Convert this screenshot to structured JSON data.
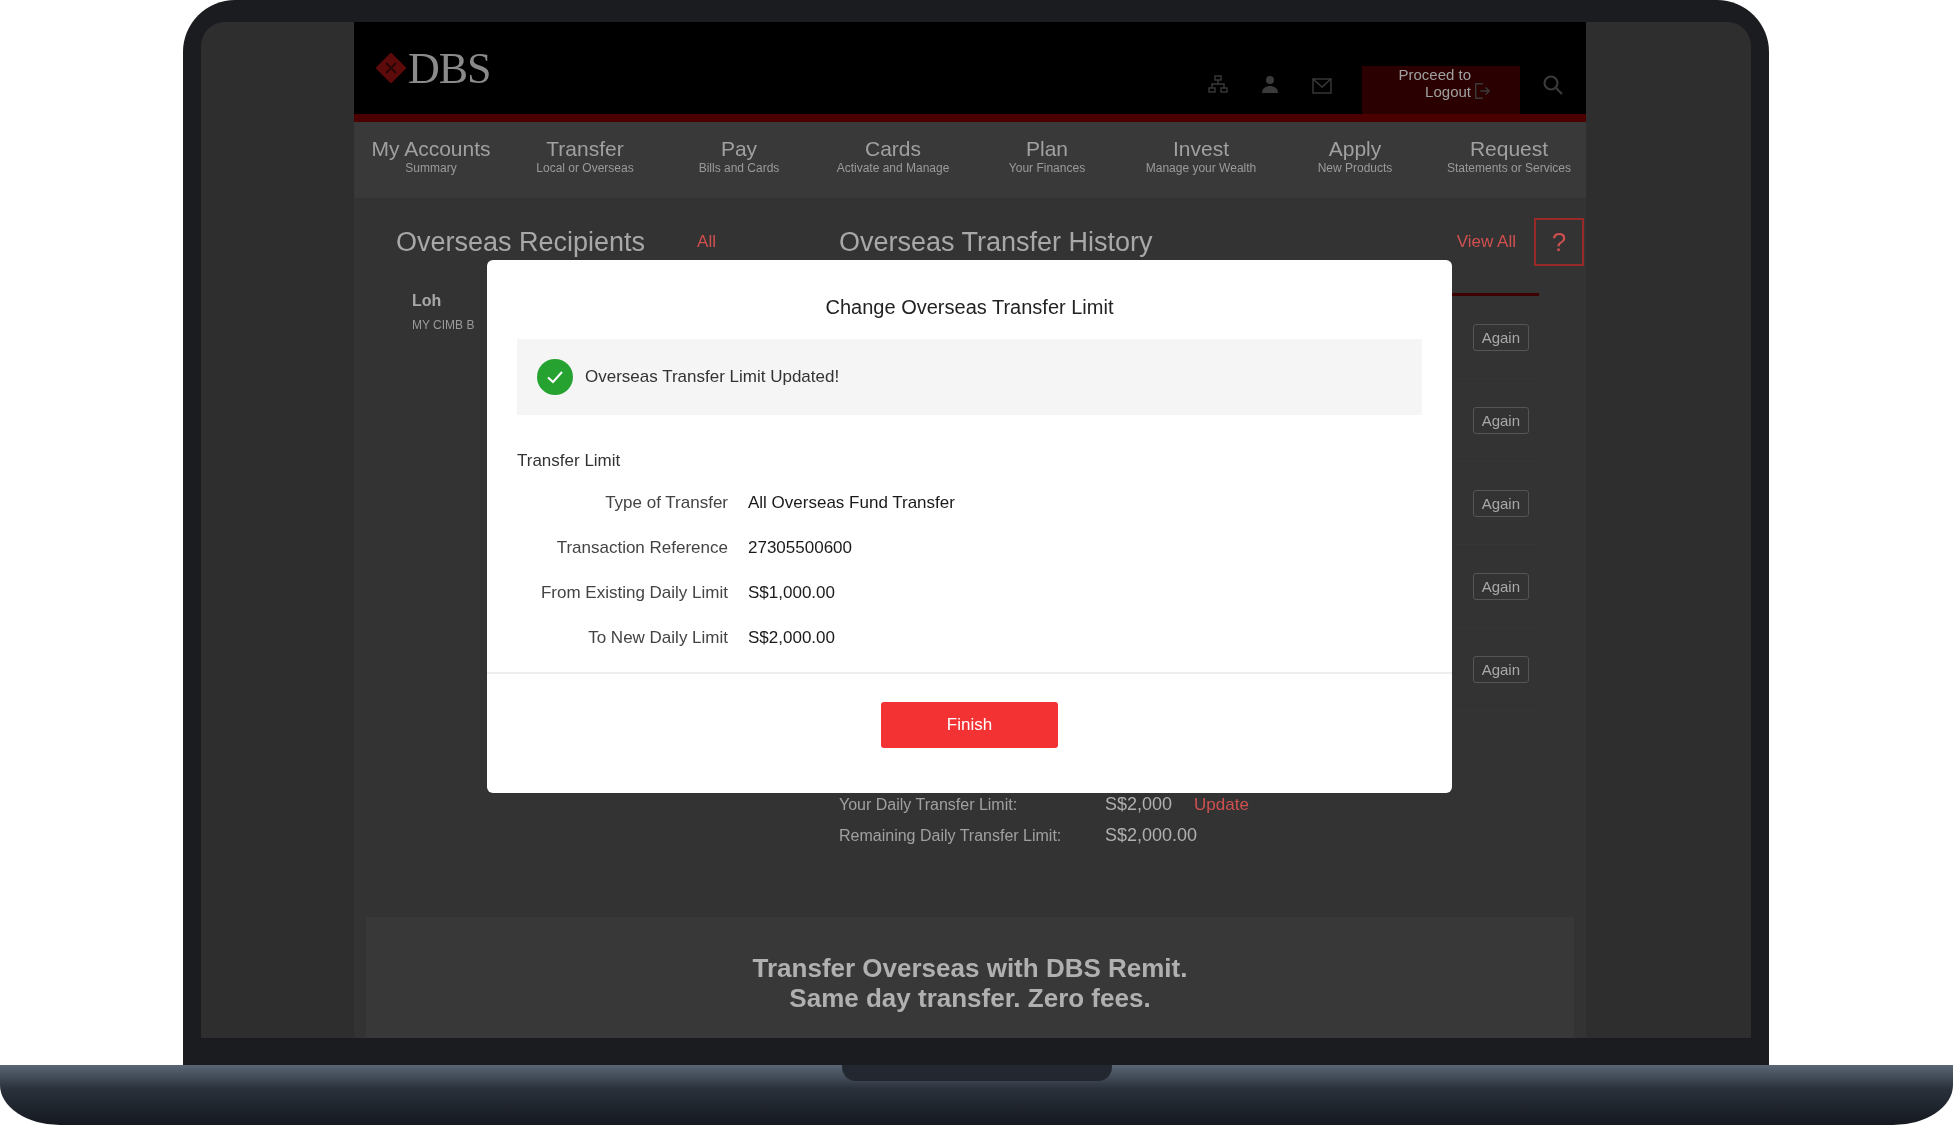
{
  "header": {
    "logo": "DBS",
    "logout": "Proceed to Logout"
  },
  "nav": [
    {
      "label": "My Accounts",
      "sub": "Summary"
    },
    {
      "label": "Transfer",
      "sub": "Local or Overseas"
    },
    {
      "label": "Pay",
      "sub": "Bills and Cards"
    },
    {
      "label": "Cards",
      "sub": "Activate and Manage"
    },
    {
      "label": "Plan",
      "sub": "Your Finances"
    },
    {
      "label": "Invest",
      "sub": "Manage your Wealth"
    },
    {
      "label": "Apply",
      "sub": "New Products"
    },
    {
      "label": "Request",
      "sub": "Statements or Services"
    }
  ],
  "recipients": {
    "title": "Overseas Recipients",
    "link": "All",
    "items": [
      {
        "name": "Loh",
        "bank": "MY CIMB B"
      }
    ]
  },
  "history": {
    "title": "Overseas Transfer History",
    "link": "View All",
    "help": "?",
    "buttons": [
      "Again",
      "Again",
      "Again",
      "Again",
      "Again"
    ]
  },
  "limits": [
    {
      "label": "Your Daily Transfer Limit:",
      "value": "S$2,000",
      "action": "Update"
    },
    {
      "label": "Remaining Daily Transfer Limit:",
      "value": "S$2,000.00"
    }
  ],
  "banner": [
    "Transfer Overseas with DBS Remit.",
    "Same day transfer. Zero fees."
  ],
  "dialog": {
    "title": "Change Overseas Transfer Limit",
    "message": "Overseas Transfer Limit Updated!",
    "section": "Transfer Limit",
    "rows": [
      {
        "label": "Type of Transfer",
        "value": "All Overseas Fund Transfer"
      },
      {
        "label": "Transaction Reference",
        "value": "27305500600"
      },
      {
        "label": "From Existing Daily Limit",
        "value": "S$1,000.00"
      },
      {
        "label": "To New Daily Limit",
        "value": "S$2,000.00"
      }
    ],
    "button": "Finish"
  }
}
